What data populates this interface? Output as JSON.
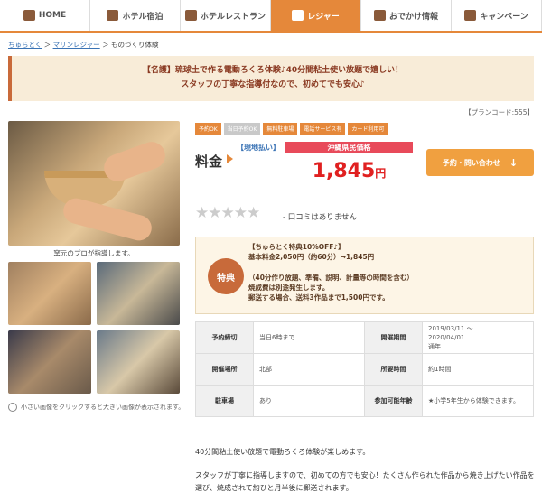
{
  "nav": {
    "items": [
      {
        "label": "HOME",
        "icon": "home-icon"
      },
      {
        "label": "ホテル宿泊",
        "icon": "hotel-icon"
      },
      {
        "label": "ホテルレストラン",
        "icon": "restaurant-icon"
      },
      {
        "label": "レジャー",
        "icon": "anchor-icon"
      },
      {
        "label": "おでかけ情報",
        "icon": "outing-icon"
      },
      {
        "label": "キャンペーン",
        "icon": "megaphone-icon"
      }
    ],
    "active_color": "#e5883a"
  },
  "breadcrumb": {
    "items": [
      "ちゅらとく",
      "マリンレジャー",
      "ものづくり体験"
    ],
    "sep": "＞"
  },
  "banner": {
    "line1": "【名護】琉球土で作る電動ろくろ体験♪40分間粘土使い放題で嬉しい！",
    "line2": "スタッフの丁寧な指導付なので、初めてでも安心♪"
  },
  "plan_code": "【プランコード:555】",
  "gallery": {
    "caption": "窯元のプロが指導します。",
    "zoom_note": "小さい画像をクリックすると大きい画像が表示されます。"
  },
  "tags": [
    {
      "label": "予約OK",
      "active": true
    },
    {
      "label": "当日予約OK",
      "active": false
    },
    {
      "label": "無料駐車場",
      "active": true
    },
    {
      "label": "電話サービス有",
      "active": true
    },
    {
      "label": "カード利用可",
      "active": true
    }
  ],
  "price": {
    "label": "料金",
    "payment": "【現地払い】",
    "box_head": "沖縄県民価格",
    "amount": "1,845",
    "unit": "円",
    "color": "#e02020"
  },
  "inquiry_button": {
    "label": "予約・問い合わせ",
    "arrow": "↓"
  },
  "rating": {
    "stars": "★★★★★",
    "review_text": "- 口コミはありません"
  },
  "benefit": {
    "badge": "特典",
    "lines": [
      "【ちゅらとく特典10%OFF♪】",
      "基本料金2,050円（約60分）→1,845円",
      "",
      "（40分作り放題、準備、説明、計量等の時間を含む）",
      "焼成費は別途発生します。",
      "郵送する場合、送料3作品まで1,500円です。"
    ]
  },
  "info": {
    "rows": [
      {
        "h1": "予約締切",
        "v1": "当日6時まで",
        "h2": "開催期間",
        "v2": "2019/03/11 ～\n2020/04/01\n通年"
      },
      {
        "h1": "開催場所",
        "v1": "北部",
        "h2": "所要時間",
        "v2": "約1時間"
      },
      {
        "h1": "駐車場",
        "v1": "あり",
        "h2": "参加可能年齢",
        "v2": "★小学5年生から体験できます。"
      }
    ]
  },
  "description": {
    "p1": "40分間粘土使い放題で電動ろくろ体験が楽しめます。",
    "p2": "スタッフが丁寧に指導しますので、初めての方でも安心！たくさん作られた作品から焼き上げたい作品を選び、焼成されて約ひと月半後に郵送されます。"
  }
}
